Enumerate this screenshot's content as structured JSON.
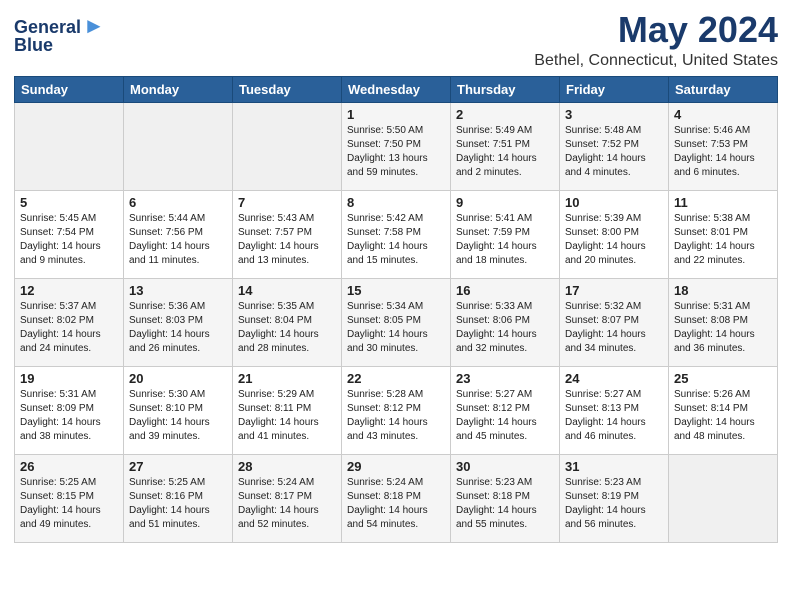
{
  "header": {
    "logo_line1": "General",
    "logo_line2": "Blue",
    "month_title": "May 2024",
    "location": "Bethel, Connecticut, United States"
  },
  "days_of_week": [
    "Sunday",
    "Monday",
    "Tuesday",
    "Wednesday",
    "Thursday",
    "Friday",
    "Saturday"
  ],
  "weeks": [
    [
      {
        "day": "",
        "info": ""
      },
      {
        "day": "",
        "info": ""
      },
      {
        "day": "",
        "info": ""
      },
      {
        "day": "1",
        "info": "Sunrise: 5:50 AM\nSunset: 7:50 PM\nDaylight: 13 hours\nand 59 minutes."
      },
      {
        "day": "2",
        "info": "Sunrise: 5:49 AM\nSunset: 7:51 PM\nDaylight: 14 hours\nand 2 minutes."
      },
      {
        "day": "3",
        "info": "Sunrise: 5:48 AM\nSunset: 7:52 PM\nDaylight: 14 hours\nand 4 minutes."
      },
      {
        "day": "4",
        "info": "Sunrise: 5:46 AM\nSunset: 7:53 PM\nDaylight: 14 hours\nand 6 minutes."
      }
    ],
    [
      {
        "day": "5",
        "info": "Sunrise: 5:45 AM\nSunset: 7:54 PM\nDaylight: 14 hours\nand 9 minutes."
      },
      {
        "day": "6",
        "info": "Sunrise: 5:44 AM\nSunset: 7:56 PM\nDaylight: 14 hours\nand 11 minutes."
      },
      {
        "day": "7",
        "info": "Sunrise: 5:43 AM\nSunset: 7:57 PM\nDaylight: 14 hours\nand 13 minutes."
      },
      {
        "day": "8",
        "info": "Sunrise: 5:42 AM\nSunset: 7:58 PM\nDaylight: 14 hours\nand 15 minutes."
      },
      {
        "day": "9",
        "info": "Sunrise: 5:41 AM\nSunset: 7:59 PM\nDaylight: 14 hours\nand 18 minutes."
      },
      {
        "day": "10",
        "info": "Sunrise: 5:39 AM\nSunset: 8:00 PM\nDaylight: 14 hours\nand 20 minutes."
      },
      {
        "day": "11",
        "info": "Sunrise: 5:38 AM\nSunset: 8:01 PM\nDaylight: 14 hours\nand 22 minutes."
      }
    ],
    [
      {
        "day": "12",
        "info": "Sunrise: 5:37 AM\nSunset: 8:02 PM\nDaylight: 14 hours\nand 24 minutes."
      },
      {
        "day": "13",
        "info": "Sunrise: 5:36 AM\nSunset: 8:03 PM\nDaylight: 14 hours\nand 26 minutes."
      },
      {
        "day": "14",
        "info": "Sunrise: 5:35 AM\nSunset: 8:04 PM\nDaylight: 14 hours\nand 28 minutes."
      },
      {
        "day": "15",
        "info": "Sunrise: 5:34 AM\nSunset: 8:05 PM\nDaylight: 14 hours\nand 30 minutes."
      },
      {
        "day": "16",
        "info": "Sunrise: 5:33 AM\nSunset: 8:06 PM\nDaylight: 14 hours\nand 32 minutes."
      },
      {
        "day": "17",
        "info": "Sunrise: 5:32 AM\nSunset: 8:07 PM\nDaylight: 14 hours\nand 34 minutes."
      },
      {
        "day": "18",
        "info": "Sunrise: 5:31 AM\nSunset: 8:08 PM\nDaylight: 14 hours\nand 36 minutes."
      }
    ],
    [
      {
        "day": "19",
        "info": "Sunrise: 5:31 AM\nSunset: 8:09 PM\nDaylight: 14 hours\nand 38 minutes."
      },
      {
        "day": "20",
        "info": "Sunrise: 5:30 AM\nSunset: 8:10 PM\nDaylight: 14 hours\nand 39 minutes."
      },
      {
        "day": "21",
        "info": "Sunrise: 5:29 AM\nSunset: 8:11 PM\nDaylight: 14 hours\nand 41 minutes."
      },
      {
        "day": "22",
        "info": "Sunrise: 5:28 AM\nSunset: 8:12 PM\nDaylight: 14 hours\nand 43 minutes."
      },
      {
        "day": "23",
        "info": "Sunrise: 5:27 AM\nSunset: 8:12 PM\nDaylight: 14 hours\nand 45 minutes."
      },
      {
        "day": "24",
        "info": "Sunrise: 5:27 AM\nSunset: 8:13 PM\nDaylight: 14 hours\nand 46 minutes."
      },
      {
        "day": "25",
        "info": "Sunrise: 5:26 AM\nSunset: 8:14 PM\nDaylight: 14 hours\nand 48 minutes."
      }
    ],
    [
      {
        "day": "26",
        "info": "Sunrise: 5:25 AM\nSunset: 8:15 PM\nDaylight: 14 hours\nand 49 minutes."
      },
      {
        "day": "27",
        "info": "Sunrise: 5:25 AM\nSunset: 8:16 PM\nDaylight: 14 hours\nand 51 minutes."
      },
      {
        "day": "28",
        "info": "Sunrise: 5:24 AM\nSunset: 8:17 PM\nDaylight: 14 hours\nand 52 minutes."
      },
      {
        "day": "29",
        "info": "Sunrise: 5:24 AM\nSunset: 8:18 PM\nDaylight: 14 hours\nand 54 minutes."
      },
      {
        "day": "30",
        "info": "Sunrise: 5:23 AM\nSunset: 8:18 PM\nDaylight: 14 hours\nand 55 minutes."
      },
      {
        "day": "31",
        "info": "Sunrise: 5:23 AM\nSunset: 8:19 PM\nDaylight: 14 hours\nand 56 minutes."
      },
      {
        "day": "",
        "info": ""
      }
    ]
  ]
}
